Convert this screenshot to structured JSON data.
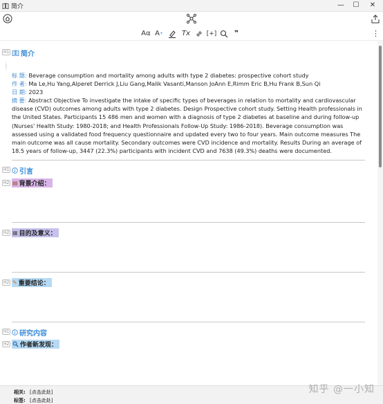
{
  "window": {
    "title": "简介",
    "minimize": "—",
    "maximize": "☐",
    "close": "✕"
  },
  "topbar": {
    "home_icon": "home-icon",
    "graph_icon": "graph-icon",
    "share_icon": "share-icon",
    "more_icon": "more-icon"
  },
  "toolbar": {
    "font": "Aα",
    "superscript": "A+",
    "clear_format": "Tx",
    "citation": "[+]",
    "quote": "❞"
  },
  "heading_badges": {
    "h1": "H1",
    "h2": "H2"
  },
  "sections": {
    "intro": {
      "title": "简介"
    },
    "preface": {
      "title": "引言"
    },
    "content": {
      "title": "研究内容"
    }
  },
  "subsections": {
    "background": {
      "title": "背景介绍：",
      "highlight": "#d8b4e8"
    },
    "purpose": {
      "title": "目的及意义：",
      "highlight": "#c5c0ec"
    },
    "conclusion": {
      "title": "重要结论：",
      "highlight": "#b6daf4"
    },
    "new_findings": {
      "title": "作者新发现：",
      "highlight": "#b6daf4"
    }
  },
  "paper": {
    "title_label": "标 题:",
    "title": "Beverage consumption and mortality among adults with type 2 diabetes: prospective cohort study",
    "authors_label": "作 者:",
    "authors": "Ma Le,Hu Yang,Alperet Derrick J,Liu Gang,Malik Vasanti,Manson JoAnn E,Rimm Eric B,Hu Frank B,Sun Qi",
    "date_label": "日 期:",
    "date": "2023",
    "abstract_label": "摘 要:",
    "abstract": "Abstract Objective To investigate the intake of specific types of beverages in relation to mortality and cardiovascular disease (CVD) outcomes among adults with type 2 diabetes. Design Prospective cohort study. Setting Health professionals in the United States. Participants 15 486 men and women with a diagnosis of type 2 diabetes at baseline and during follow-up (Nurses' Health Study: 1980-2018; and Health Professionals Follow-Up Study: 1986-2018). Beverage consumption was assessed using a validated food frequency questionnaire and updated every two to four years. Main outcome measures The main outcome was all cause mortality. Secondary outcomes were CVD incidence and mortality. Results During an average of 18.5 years of follow-up, 3447 (22.3%) participants with incident CVD and 7638 (49.3%) deaths were documented."
  },
  "footer": {
    "related_label": "相关:",
    "related_value": "[点击此处]",
    "tags_label": "标签:",
    "tags_value": "[点击此处]"
  },
  "watermark": "知乎 @一小知",
  "colors": {
    "heading_blue": "#3a8bd8",
    "meta_label_blue": "#4a8fcf"
  }
}
